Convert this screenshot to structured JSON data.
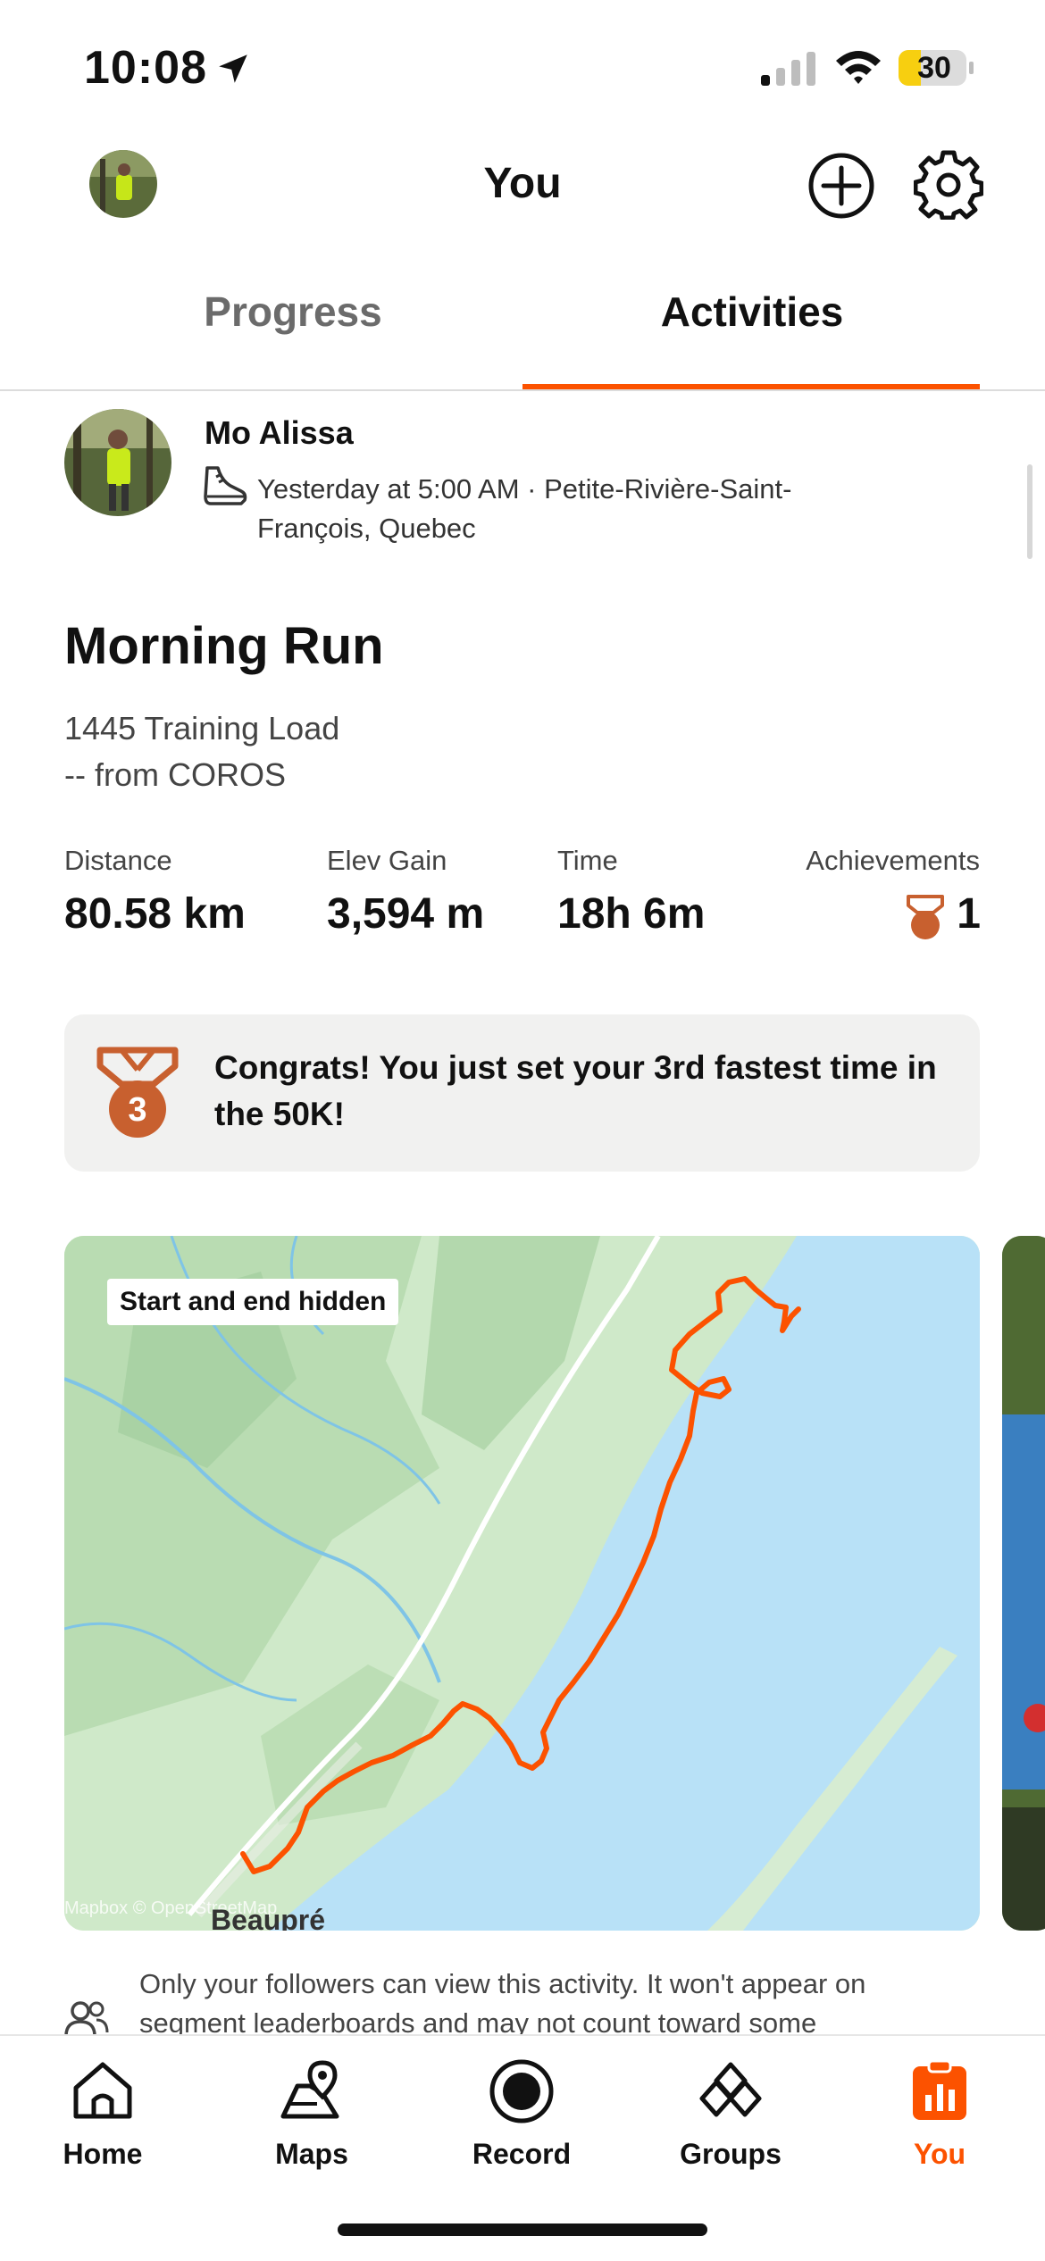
{
  "status_bar": {
    "time": "10:08",
    "battery": "30"
  },
  "header": {
    "title": "You"
  },
  "tabs": [
    {
      "label": "Progress",
      "active": false
    },
    {
      "label": "Activities",
      "active": true
    }
  ],
  "activity": {
    "athlete_name": "Mo Alissa",
    "meta": "Yesterday at 5:00 AM · Petite-Rivière-Saint-François, Quebec",
    "title": "Morning Run",
    "description_line1": "1445 Training Load",
    "description_line2": "-- from COROS",
    "stats": [
      {
        "label": "Distance",
        "value": "80.58 km"
      },
      {
        "label": "Elev Gain",
        "value": "3,594 m"
      },
      {
        "label": "Time",
        "value": "18h 6m"
      }
    ],
    "achievements": {
      "label": "Achievements",
      "value": "1"
    },
    "congrats": "Congrats! You just set your 3rd fastest time in the 50K!",
    "medal_number": "3",
    "map": {
      "badge": "Start and end hidden",
      "credit": "Mapbox © OpenStreetMap",
      "city": "Beaupré"
    },
    "privacy": "Only your followers can view this activity. It won't appear on segment leaderboards and may not count toward some"
  },
  "nav": [
    {
      "label": "Home",
      "icon": "home-icon",
      "active": false
    },
    {
      "label": "Maps",
      "icon": "maps-icon",
      "active": false
    },
    {
      "label": "Record",
      "icon": "record-icon",
      "active": false
    },
    {
      "label": "Groups",
      "icon": "groups-icon",
      "active": false
    },
    {
      "label": "You",
      "icon": "you-icon",
      "active": true
    }
  ],
  "colors": {
    "accent": "#fc5200",
    "medal": "#c8602f",
    "water": "#b8e1f7",
    "land": "#cfe9c9"
  }
}
